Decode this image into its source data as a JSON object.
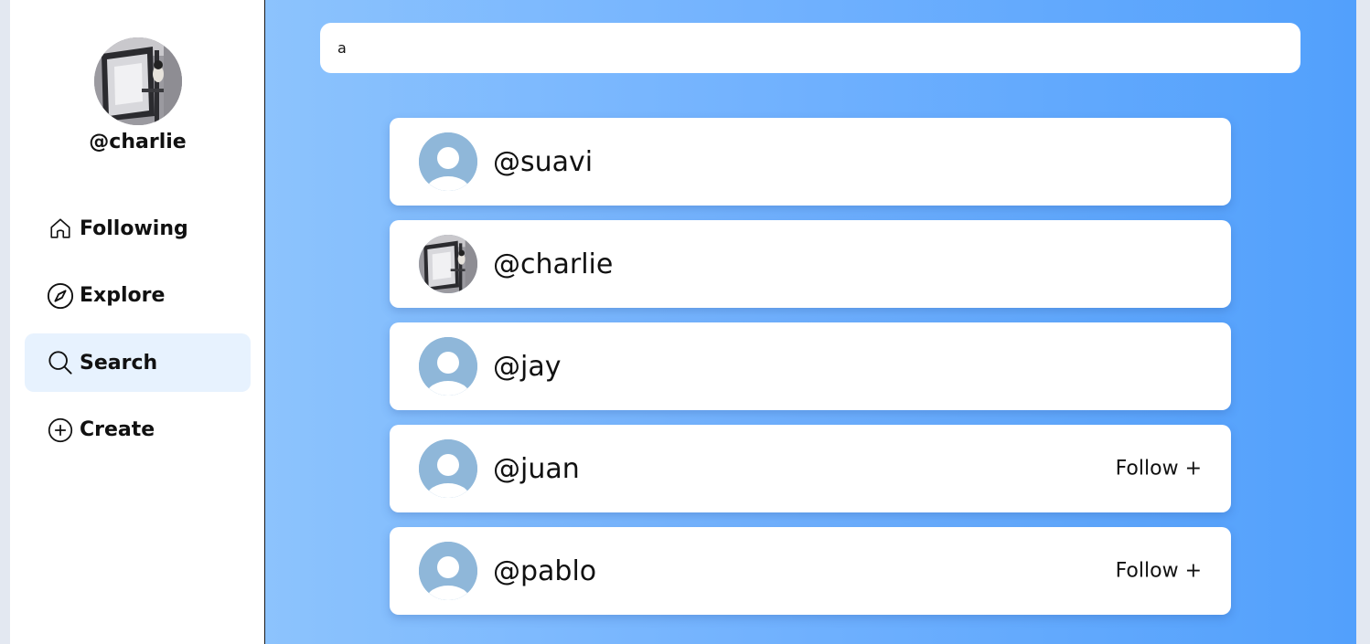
{
  "profile": {
    "handle": "@charlie"
  },
  "nav": [
    {
      "label": "Following",
      "icon": "home-icon"
    },
    {
      "label": "Explore",
      "icon": "compass-icon"
    },
    {
      "label": "Search",
      "icon": "search-icon",
      "active": true
    },
    {
      "label": "Create",
      "icon": "plus-circle-icon"
    }
  ],
  "search": {
    "value": "a"
  },
  "results": [
    {
      "handle": "@suavi",
      "avatar": "default",
      "follow_label": ""
    },
    {
      "handle": "@charlie",
      "avatar": "photo",
      "follow_label": ""
    },
    {
      "handle": "@jay",
      "avatar": "default",
      "follow_label": ""
    },
    {
      "handle": "@juan",
      "avatar": "default",
      "follow_label": "Follow +"
    },
    {
      "handle": "@pablo",
      "avatar": "default",
      "follow_label": "Follow +"
    }
  ],
  "colors": {
    "accent_gradient_start": "#8cc3fd",
    "accent_gradient_end": "#52a0fc",
    "nav_active_bg": "#e7f2fe",
    "default_avatar": "#8fb7d9"
  }
}
